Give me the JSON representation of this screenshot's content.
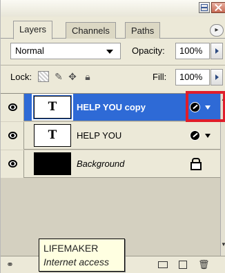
{
  "tabs": [
    {
      "label": "Layers",
      "active": true
    },
    {
      "label": "Channels",
      "active": false
    },
    {
      "label": "Paths",
      "active": false
    }
  ],
  "blend": {
    "mode": "Normal",
    "opacity_label": "Opacity:",
    "opacity_value": "100%"
  },
  "lock": {
    "label": "Lock:",
    "fill_label": "Fill:",
    "fill_value": "100%"
  },
  "layers": [
    {
      "name": "HELP YOU copy",
      "thumb": "T",
      "selected": true,
      "has_effects": true
    },
    {
      "name": "HELP YOU",
      "thumb": "T",
      "selected": false,
      "has_effects": true
    },
    {
      "name": "Background",
      "thumb": "",
      "selected": false,
      "locked": true
    }
  ],
  "tooltip": {
    "title": "LIFEMAKER",
    "subtitle": "Internet access"
  },
  "colors": {
    "selection": "#2e6ad6",
    "highlight": "#e01d2a",
    "panel": "#ece9d8"
  }
}
